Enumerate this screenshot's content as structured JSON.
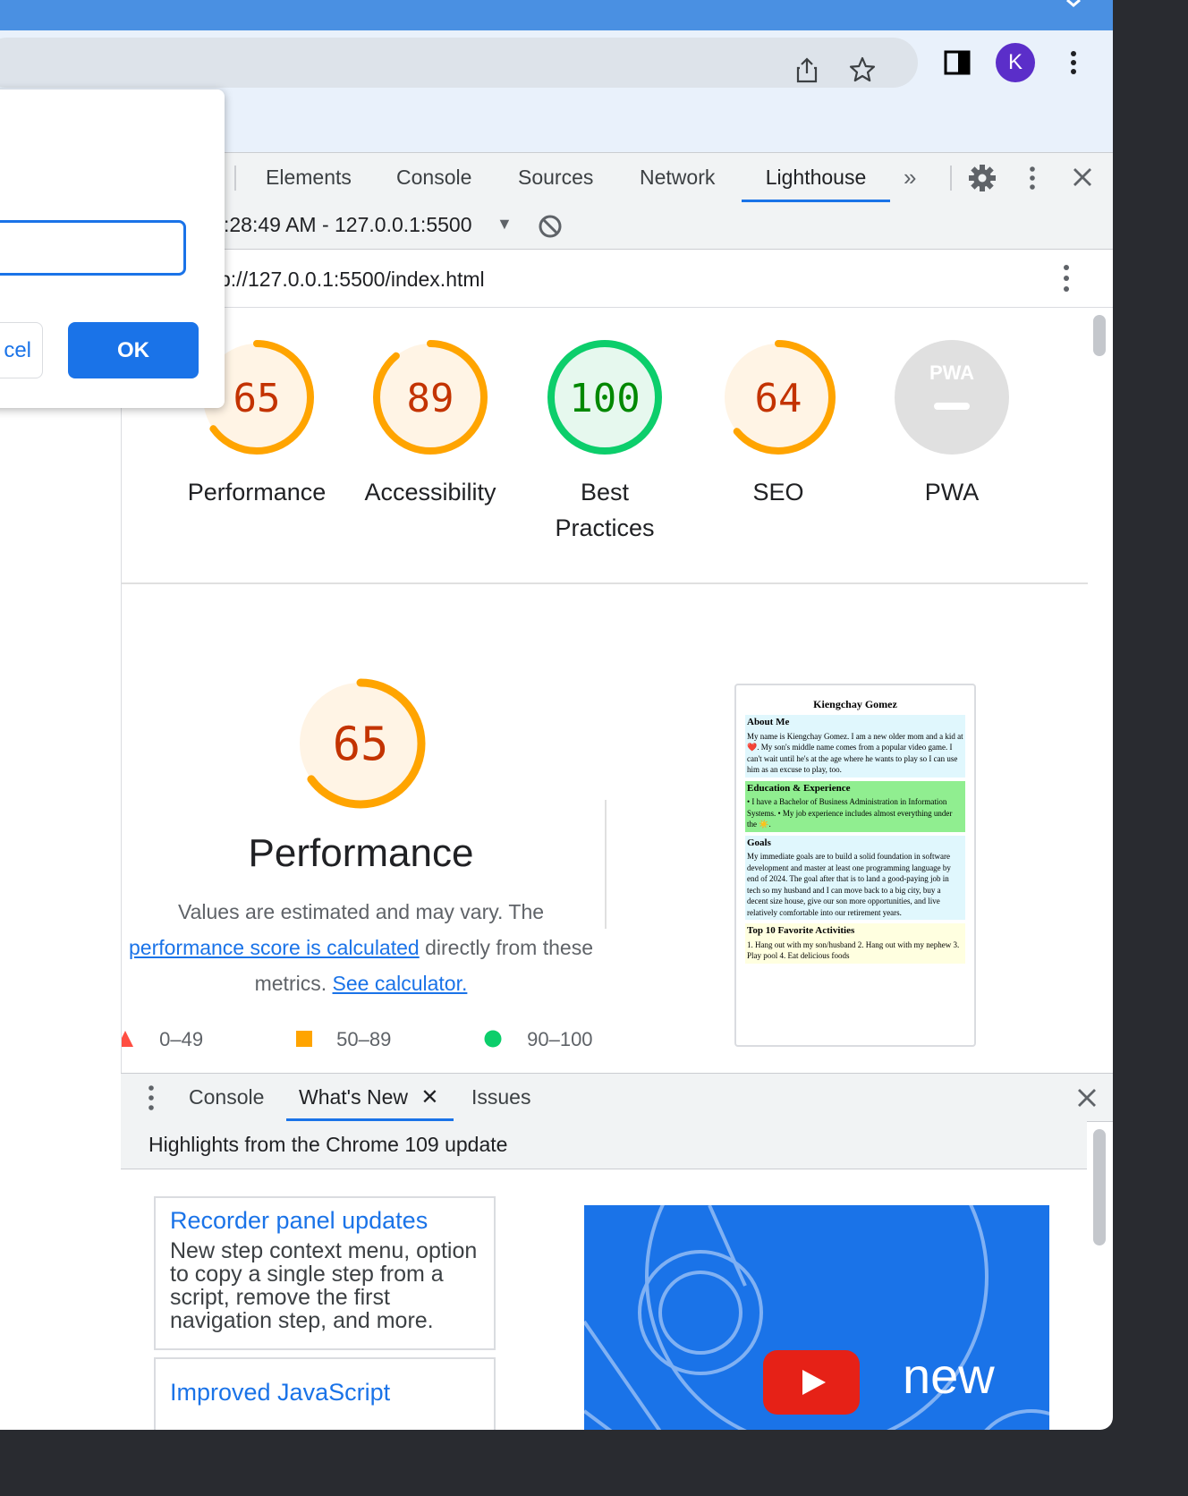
{
  "browser": {
    "profile_initial": "K"
  },
  "devtools": {
    "tabs": [
      "Elements",
      "Console",
      "Sources",
      "Network",
      "Lighthouse"
    ],
    "active_tab": "Lighthouse",
    "report_select": ":28:49 AM - 127.0.0.1:5500",
    "url": "p://127.0.0.1:5500/index.html"
  },
  "lighthouse": {
    "categories": [
      {
        "label": "Performance",
        "score": "65",
        "value": 65,
        "rating": "average"
      },
      {
        "label": "Accessibility",
        "score": "89",
        "value": 89,
        "rating": "average"
      },
      {
        "label": "Best Practices",
        "score": "100",
        "value": 100,
        "rating": "pass"
      },
      {
        "label": "SEO",
        "score": "64",
        "value": 64,
        "rating": "average"
      },
      {
        "label": "PWA",
        "score": "PWA",
        "value": null,
        "rating": "na"
      }
    ],
    "performance": {
      "score": "65",
      "value": 65,
      "title": "Performance",
      "desc_pre": "Values are estimated and may vary. The ",
      "desc_link1": "performance score is calculated",
      "desc_mid": " directly from these metrics. ",
      "desc_link2": "See calculator."
    },
    "legend": [
      "0–49",
      "50–89",
      "90–100"
    ],
    "colors": {
      "average": "#ffa400",
      "average_text": "#c33300",
      "pass": "#0cce6b",
      "pass_text": "#008800",
      "fail": "#ff4e42",
      "na": "#e0e0e0"
    },
    "screenshot": {
      "name": "Kiengchay Gomez",
      "sections": [
        {
          "heading": "About Me",
          "text": "My name is Kiengchay Gomez. I am a new older mom and a kid at ❤️. My son's middle name comes from a popular video game. I can't wait until he's at the age where he wants to play so I can use him as an excuse to play, too.",
          "color": "#e0f7fd"
        },
        {
          "heading": "Education & Experience",
          "text": "• I have a Bachelor of Business Administration in Information Systems. • My job experience includes almost everything under the ☀️.",
          "color": "#90ee90"
        },
        {
          "heading": "Goals",
          "text": "My immediate goals are to build a solid foundation in software development and master at least one programming language by end of 2024. The goal after that is to land a good-paying job in tech so my husband and I can move back to a big city, buy a decent size house, give our son more opportunities, and live relatively comfortable into our retirement years.",
          "color": "#e0f7fd"
        },
        {
          "heading": "Top 10 Favorite Activities",
          "text": "1. Hang out with my son/husband 2. Hang out with my nephew 3. Play pool 4. Eat delicious foods",
          "color": "#ffffe0"
        }
      ]
    }
  },
  "drawer": {
    "tabs": [
      "Console",
      "What's New",
      "Issues"
    ],
    "active_tab": "What's New",
    "highlights": "Highlights from the Chrome 109 update",
    "cards": [
      {
        "title": "Recorder panel updates",
        "desc": "New step context menu, option to copy a single step from a script, remove the first navigation step, and more."
      },
      {
        "title": "Improved JavaScript debugging",
        "desc": ""
      }
    ],
    "video_text": "new"
  },
  "dialog": {
    "input_value": "",
    "cancel_label": "cel",
    "ok_label": "OK"
  }
}
